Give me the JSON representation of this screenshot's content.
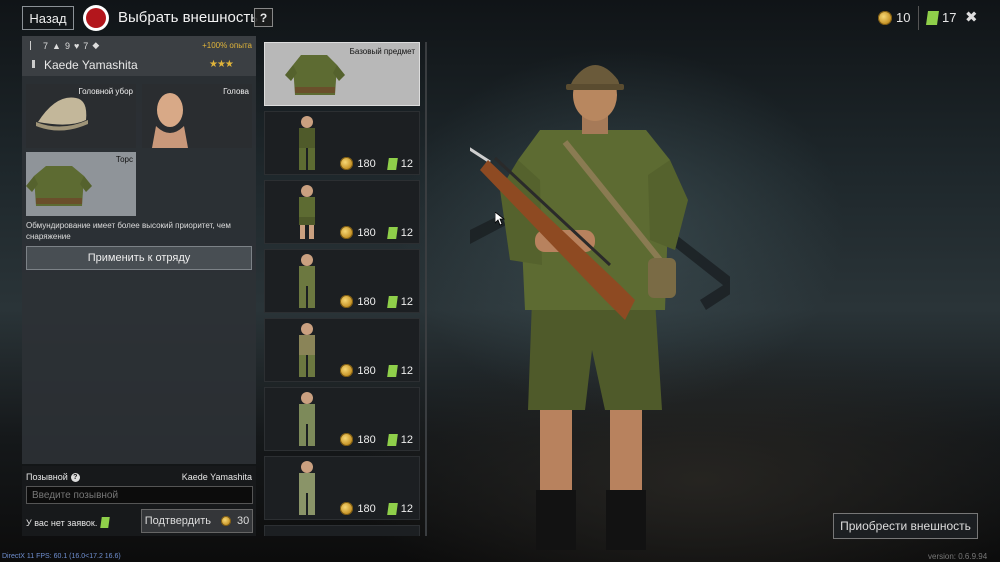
{
  "header": {
    "back_label": "Назад",
    "title": "Выбрать внешность",
    "help_label": "?",
    "gold_amount": "10",
    "tickets_amount": "17",
    "close_label": "✖"
  },
  "soldier": {
    "stat_1": "7",
    "stat_2": "9",
    "stat_3": "7",
    "xp_bonus": "+100% опыта",
    "name": "Kaede Yamashita",
    "stars": "★★★"
  },
  "slots": [
    {
      "label": "Головной убор",
      "icon": "cap-icon"
    },
    {
      "label": "Голова",
      "icon": "head-icon"
    },
    {
      "label": "Торс",
      "icon": "torso-icon"
    }
  ],
  "priority_note": "Обмундирование имеет более высокий приоритет, чем снаряжение",
  "apply_button": "Применить к отряду",
  "callsign": {
    "label": "Позывной",
    "name": "Kaede Yamashita",
    "placeholder": "Введите позывной",
    "no_requests": "У вас нет заявок.",
    "confirm_label": "Подтвердить",
    "confirm_price": "30"
  },
  "items": [
    {
      "label": "Базовый предмет",
      "selected": true
    },
    {
      "gold": "180",
      "tickets": "12"
    },
    {
      "gold": "180",
      "tickets": "12"
    },
    {
      "gold": "180",
      "tickets": "12"
    },
    {
      "gold": "180",
      "tickets": "12"
    },
    {
      "gold": "180",
      "tickets": "12"
    },
    {
      "gold": "180",
      "tickets": "12"
    }
  ],
  "buy_button": "Приобрести внешность",
  "debug_text": "DirectX 11 FPS: 60.1 (16.0<17.2 16.6)",
  "version_text": "version: 0.6.9.94",
  "colors": {
    "accent_gold": "#e0b43a",
    "record_red": "#b3161c",
    "ticket_green": "#8fcf4a",
    "uniform_green": "#5d6b32"
  }
}
